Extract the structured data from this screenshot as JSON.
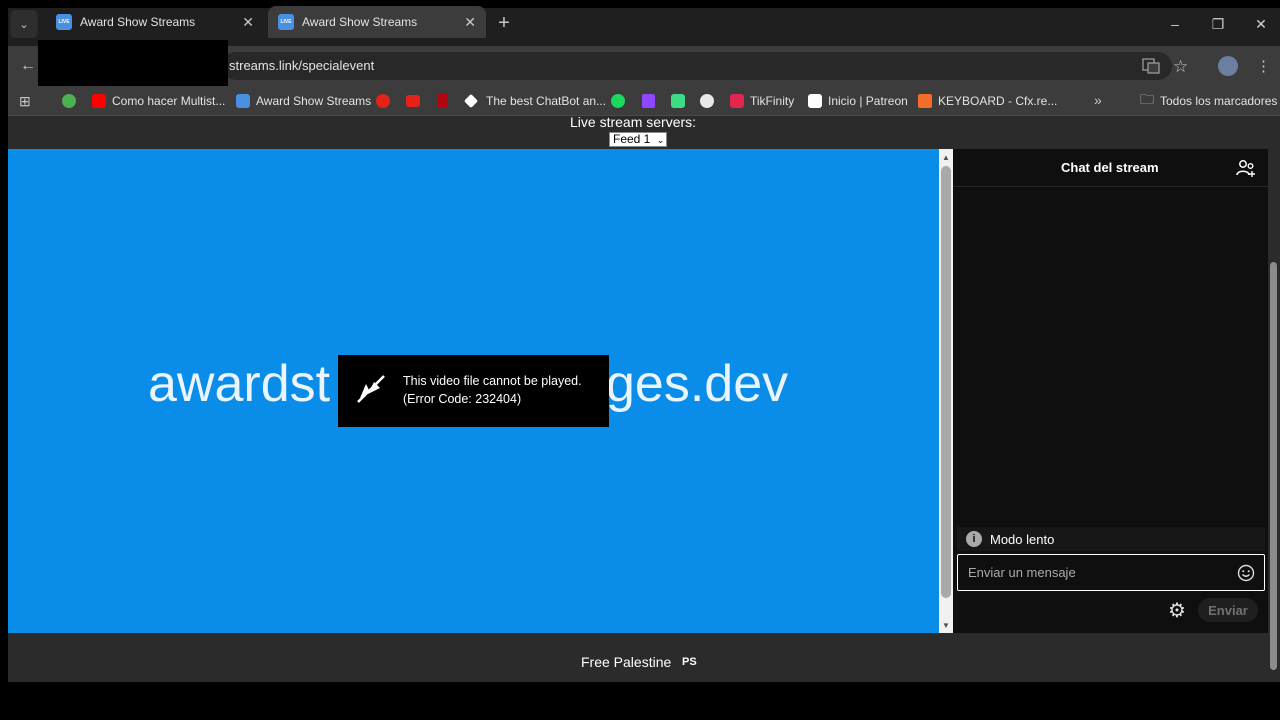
{
  "browser": {
    "tabs": [
      {
        "label": "Award Show Streams",
        "favicon": "LIVE"
      },
      {
        "label": "Award Show Streams",
        "favicon": "LIVE"
      }
    ],
    "url": "streams.link/specialevent"
  },
  "bookmarks": [
    {
      "label": "Como hacer Multist...",
      "icon": "youtube-icon",
      "color": "#ff0000"
    },
    {
      "label": "Award Show Streams",
      "icon": "live-icon",
      "color": "#4a90e2"
    },
    {
      "label": "The best ChatBot an...",
      "icon": "diamond-icon",
      "color": "#ffffff"
    },
    {
      "label": "TikFinity",
      "icon": "tikfinity-icon",
      "color": "#e2264d"
    },
    {
      "label": "Inicio | Patreon",
      "icon": "patreon-icon",
      "color": "#ffffff"
    },
    {
      "label": "KEYBOARD - Cfx.re...",
      "icon": "cfx-icon",
      "color": "#f26c2b"
    },
    {
      "label": "Todos los marcadores",
      "icon": "folder-icon",
      "color": "#e3e3e3"
    }
  ],
  "page": {
    "servers_label": "Live stream servers:",
    "feed_selected": "Feed 1",
    "watermark_left": "awardst",
    "watermark_right": "ges.dev",
    "video_bg": "#0a8ce9",
    "error": {
      "line1": "This video file cannot be played.",
      "line2": "(Error Code: 232404)"
    },
    "footer": "Free Palestine",
    "footer_flag": "PS"
  },
  "chat": {
    "title": "Chat del stream",
    "slow_mode": "Modo lento",
    "input_placeholder": "Enviar un mensaje",
    "send_label": "Enviar"
  }
}
